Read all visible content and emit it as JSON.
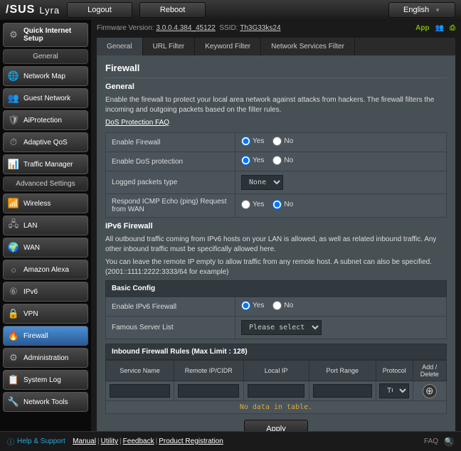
{
  "header": {
    "brand": "/SUS",
    "product": "Lyra",
    "logout": "Logout",
    "reboot": "Reboot",
    "language": "English"
  },
  "topinfo": {
    "fw_label": "Firmware Version:",
    "fw_value": "3.0.0.4.384_45122",
    "ssid_label": "SSID:",
    "ssid_value": "Th3G33ks24",
    "app": "App"
  },
  "sidebar": {
    "quick": "Quick Internet\nSetup",
    "general_hdr": "General",
    "general": [
      "Network Map",
      "Guest Network",
      "AiProtection",
      "Adaptive QoS",
      "Traffic Manager"
    ],
    "advanced_hdr": "Advanced Settings",
    "advanced": [
      "Wireless",
      "LAN",
      "WAN",
      "Amazon Alexa",
      "IPv6",
      "VPN",
      "Firewall",
      "Administration",
      "System Log",
      "Network Tools"
    ]
  },
  "tabs": [
    "General",
    "URL Filter",
    "Keyword Filter",
    "Network Services Filter"
  ],
  "page": {
    "title": "Firewall",
    "sec1": "General",
    "desc1": "Enable the firewall to protect your local area network against attacks from hackers. The firewall filters the incoming and outgoing packets based on the filter rules.",
    "dos_link": "DoS Protection FAQ",
    "rows": {
      "enable_fw": "Enable Firewall",
      "enable_dos": "Enable DoS protection",
      "logged": "Logged packets type",
      "logged_val": "None",
      "icmp": "Respond ICMP Echo (ping) Request from WAN"
    },
    "opt_yes": "Yes",
    "opt_no": "No",
    "sec2": "IPv6 Firewall",
    "desc2": "All outbound traffic coming from IPv6 hosts on your LAN is allowed, as well as related inbound traffic. Any other inbound traffic must be specifically allowed here.",
    "desc3": "You can leave the remote IP empty to allow traffic from any remote host. A subnet can also be specified. (2001::1111:2222:3333/64 for example)",
    "basic": "Basic Config",
    "enable_v6": "Enable IPv6 Firewall",
    "famous": "Famous Server List",
    "famous_val": "Please select",
    "rules_hdr": "Inbound Firewall Rules (Max Limit : 128)",
    "cols": [
      "Service Name",
      "Remote IP/CIDR",
      "Local IP",
      "Port Range",
      "Protocol",
      "Add / Delete"
    ],
    "proto": "TCP",
    "nodata": "No data in table.",
    "apply": "Apply"
  },
  "footer": {
    "help": "Help & Support",
    "links": [
      "Manual",
      "Utility",
      "Feedback",
      "Product Registration"
    ],
    "faq": "FAQ"
  }
}
